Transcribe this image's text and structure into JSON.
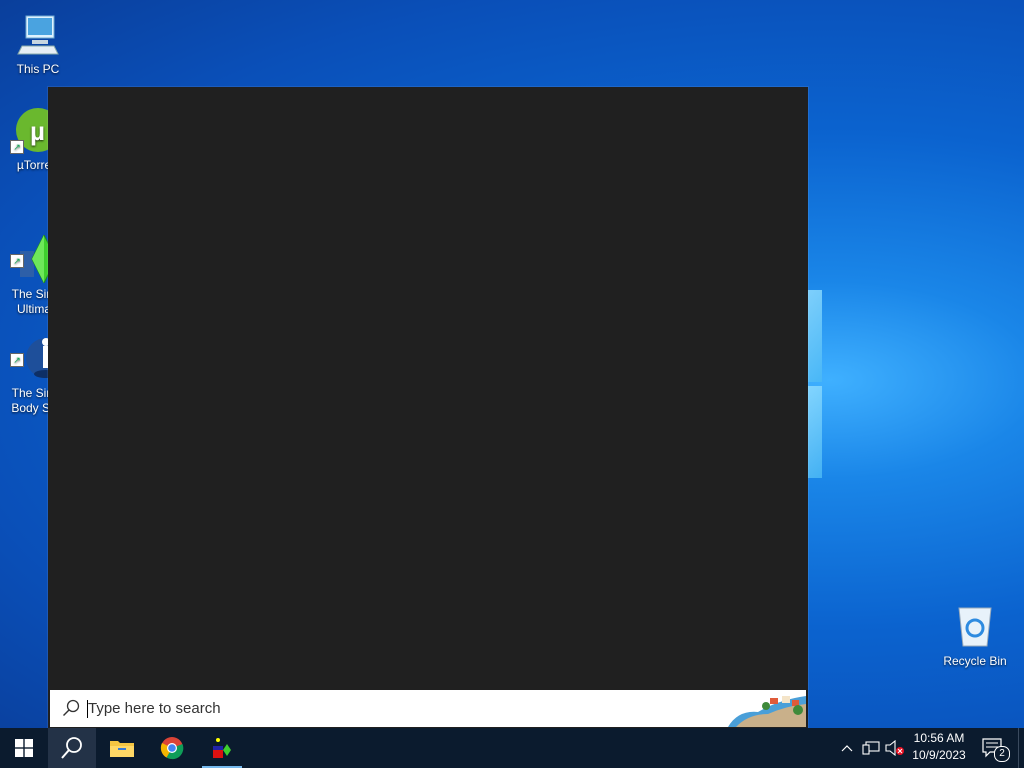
{
  "desktop": {
    "icons": [
      {
        "name": "this-pc",
        "label": "This PC"
      },
      {
        "name": "utorrent",
        "label": "µTorre"
      },
      {
        "name": "sims-ultimate",
        "label": "The Sim\nUltima"
      },
      {
        "name": "sims-body-shop",
        "label": "The Sim\nBody Sh"
      },
      {
        "name": "recycle-bin",
        "label": "Recycle Bin"
      }
    ]
  },
  "search": {
    "placeholder": "Type here to search"
  },
  "taskbar": {
    "apps": [
      "start",
      "search",
      "file-explorer",
      "chrome",
      "sims-app"
    ],
    "clock": {
      "time": "10:56 AM",
      "date": "10/9/2023"
    },
    "notifications_count": "2"
  },
  "colors": {
    "panel_bg": "#202020",
    "taskbar_bg": "#0b1b2e",
    "accent": "#76b9ed"
  }
}
